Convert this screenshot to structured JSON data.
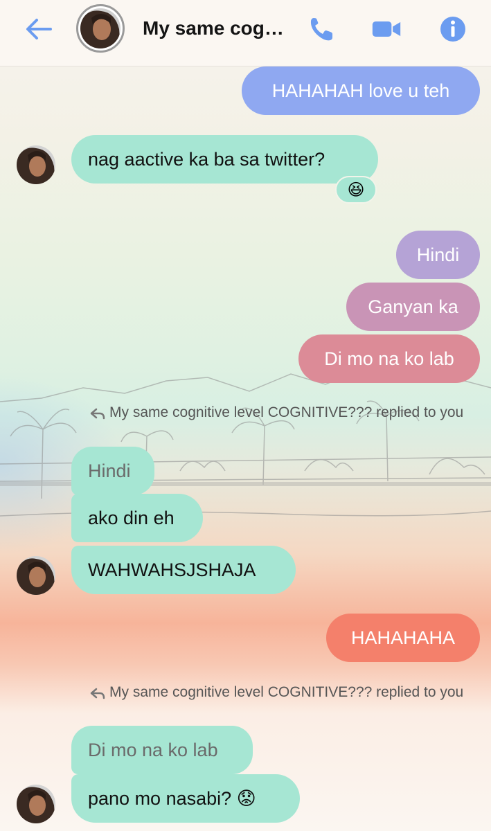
{
  "header": {
    "title": "My same cog…"
  },
  "messages": {
    "m1": "HAHAHAH love u teh",
    "m2": "nag aactive ka ba sa twitter?",
    "m2_reaction": "😆",
    "m3": "Hindi",
    "m4": "Ganyan ka",
    "m5": "Di mo na ko lab",
    "reply1": "My same cognitive level COGNITIVE??? replied to you",
    "m6_quoted": "Hindi",
    "m7": "ako din eh",
    "m8": "WAHWAHSJSHAJA",
    "m9": "HAHAHAHA",
    "reply2": "My same cognitive level COGNITIVE??? replied to you",
    "m10_quoted": "Di mo na ko lab",
    "m11": "pano mo nasabi? 😟"
  },
  "colors": {
    "accent": "#6b9cf0",
    "incoming": "#a6e6d3",
    "out1": "#8fa8f1",
    "out2": "#b5a3d6",
    "out3": "#c994b6",
    "out4": "#dc8b97",
    "out5": "#f4806b"
  },
  "icons": [
    "back-arrow-icon",
    "phone-icon",
    "video-camera-icon",
    "info-icon",
    "reply-arrow-icon"
  ]
}
